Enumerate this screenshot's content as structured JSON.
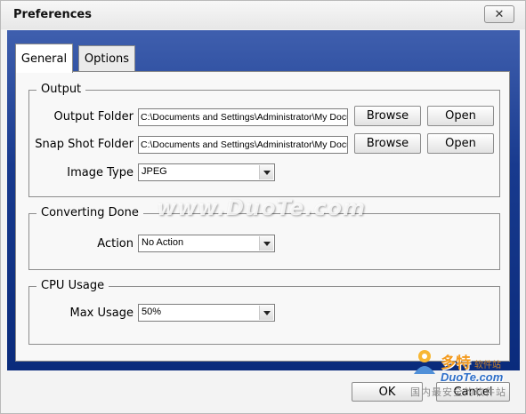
{
  "window": {
    "title": "Preferences",
    "close_symbol": "✕"
  },
  "tabs": [
    {
      "label": "General",
      "selected": true
    },
    {
      "label": "Options",
      "selected": false
    }
  ],
  "output": {
    "group_label": "Output",
    "output_folder_label": "Output Folder",
    "output_folder_value": "C:\\Documents and Settings\\Administrator\\My Documents",
    "snapshot_folder_label": "Snap Shot Folder",
    "snapshot_folder_value": "C:\\Documents and Settings\\Administrator\\My Documents",
    "browse_label": "Browse",
    "open_label": "Open",
    "image_type_label": "Image Type",
    "image_type_value": "JPEG"
  },
  "converting_done": {
    "group_label": "Converting Done",
    "action_label": "Action",
    "action_value": "No Action"
  },
  "cpu_usage": {
    "group_label": "CPU Usage",
    "max_usage_label": "Max Usage",
    "max_usage_value": "50%"
  },
  "footer": {
    "ok_label": "OK",
    "cancel_label": "Cancel"
  },
  "watermark": {
    "text": "www.DuoTe.com",
    "logo_text": "多特",
    "logo_sub": "软件站",
    "logo_url": "DuoTe.com",
    "logo_cn": "国内最安全的软件站"
  },
  "colors": {
    "accent_blue": "#183a8e",
    "logo_orange": "#f39a1d"
  }
}
